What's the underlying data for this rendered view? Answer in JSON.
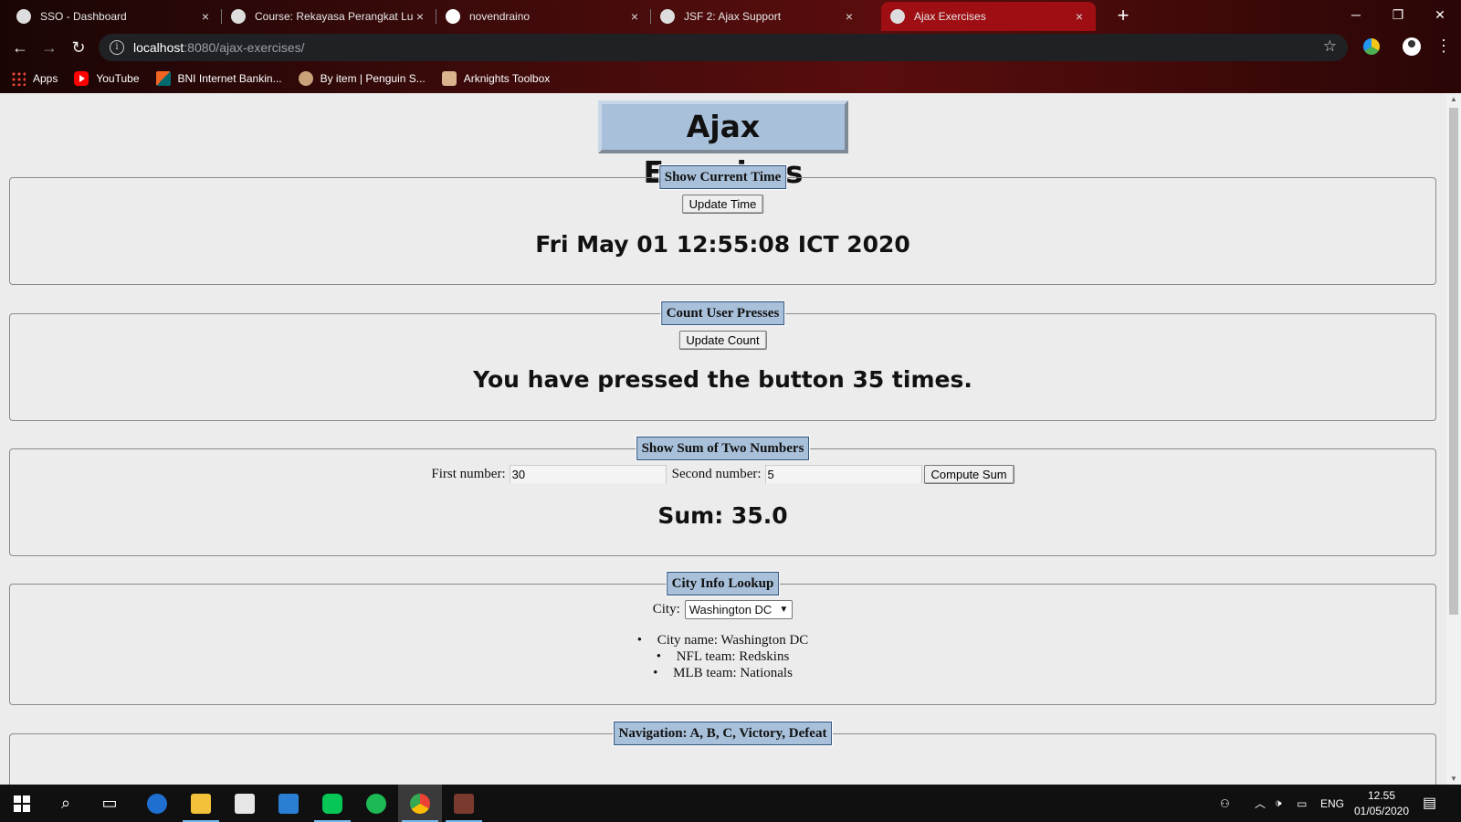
{
  "browser": {
    "tabs": [
      {
        "label": "SSO - Dashboard",
        "close": "×"
      },
      {
        "label": "Course: Rekayasa Perangkat Luna",
        "close": "×"
      },
      {
        "label": "novendraino",
        "close": "×"
      },
      {
        "label": "JSF 2: Ajax Support",
        "close": "×"
      },
      {
        "label": "Ajax Exercises",
        "close": "×"
      }
    ],
    "new_tab": "+",
    "window_controls": {
      "minimize": "─",
      "restore": "❐",
      "close": "✕"
    },
    "nav": {
      "back": "←",
      "forward": "→",
      "reload": "↻"
    },
    "url_host": "localhost",
    "url_path": ":8080/ajax-exercises/",
    "bookmarks": [
      {
        "label": "Apps",
        "icon": "apps-grid-icon"
      },
      {
        "label": "YouTube",
        "icon": "youtube-icon"
      },
      {
        "label": "BNI Internet Bankin...",
        "icon": "bni-icon"
      },
      {
        "label": "By item | Penguin S...",
        "icon": "penguin-icon"
      },
      {
        "label": "Arknights Toolbox",
        "icon": "arknights-icon"
      }
    ]
  },
  "page": {
    "title": "Ajax Exercises",
    "time_section": {
      "legend": "Show Current Time",
      "button": "Update Time",
      "result": "Fri May 01 12:55:08 ICT 2020"
    },
    "count_section": {
      "legend": "Count User Presses",
      "button": "Update Count",
      "result": "You have pressed the button 35 times."
    },
    "sum_section": {
      "legend": "Show Sum of Two Numbers",
      "first_label": "First number:",
      "first_value": "30",
      "second_label": "Second number:",
      "second_value": "5",
      "button": "Compute Sum",
      "result": "Sum: 35.0"
    },
    "city_section": {
      "legend": "City Info Lookup",
      "city_label": "City:",
      "selected_city": "Washington DC",
      "info": [
        "City name: Washington DC",
        "NFL team: Redskins",
        "MLB team: Nationals"
      ]
    },
    "nav_section": {
      "legend": "Navigation: A, B, C, Victory, Defeat"
    }
  },
  "taskbar": {
    "lang": "ENG",
    "time": "12.55",
    "date": "01/05/2020"
  }
}
